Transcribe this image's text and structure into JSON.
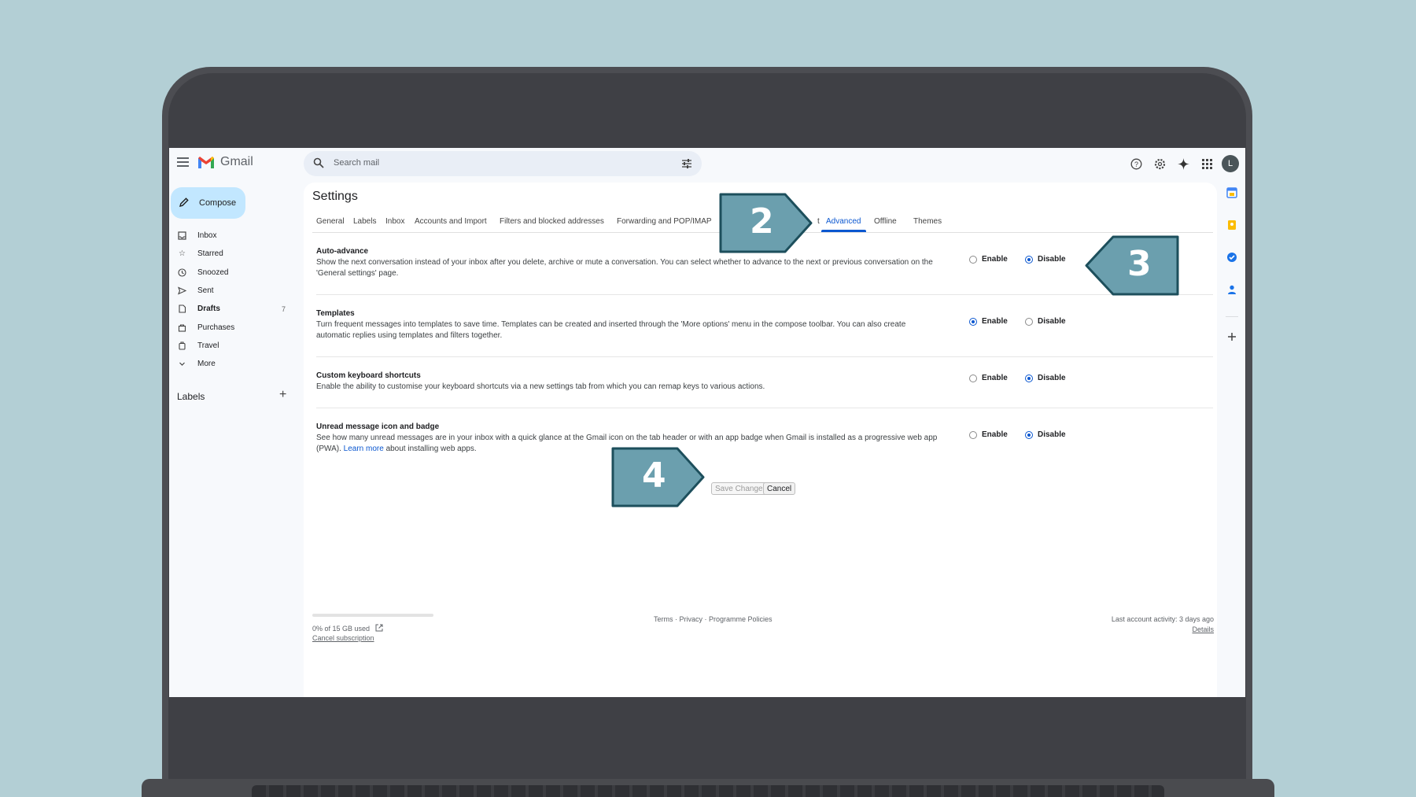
{
  "app": {
    "name": "Gmail"
  },
  "search": {
    "placeholder": "Search mail"
  },
  "header": {
    "avatar_letter": "L"
  },
  "sidebar": {
    "compose_label": "Compose",
    "items": [
      {
        "label": "Inbox",
        "icon": "inbox-icon",
        "count": ""
      },
      {
        "label": "Starred",
        "icon": "star-icon",
        "count": ""
      },
      {
        "label": "Snoozed",
        "icon": "clock-icon",
        "count": ""
      },
      {
        "label": "Sent",
        "icon": "send-icon",
        "count": ""
      },
      {
        "label": "Drafts",
        "icon": "draft-icon",
        "count": "7"
      },
      {
        "label": "Purchases",
        "icon": "bag-icon",
        "count": ""
      },
      {
        "label": "Travel",
        "icon": "luggage-icon",
        "count": ""
      },
      {
        "label": "More",
        "icon": "chevron-down-icon",
        "count": ""
      }
    ],
    "labels_title": "Labels"
  },
  "settings": {
    "title": "Settings",
    "tabs": [
      "General",
      "Labels",
      "Inbox",
      "Accounts and Import",
      "Filters and blocked addresses",
      "Forwarding and POP/IMAP",
      "t",
      "Advanced",
      "Offline",
      "Themes"
    ],
    "active_tab": "Advanced",
    "rows": [
      {
        "title": "Auto-advance",
        "desc": "Show the next conversation instead of your inbox after you delete, archive or mute a conversation. You can select whether to advance to the next or previous conversation on the 'General settings' page.",
        "selected": "Disable"
      },
      {
        "title": "Templates",
        "desc": "Turn frequent messages into templates to save time. Templates can be created and inserted through the 'More options' menu in the compose toolbar. You can also create automatic replies using templates and filters together.",
        "selected": "Enable"
      },
      {
        "title": "Custom keyboard shortcuts",
        "desc": "Enable the ability to customise your keyboard shortcuts via a new settings tab from which you can remap keys to various actions.",
        "selected": "Disable"
      },
      {
        "title": "Unread message icon and badge",
        "desc_before": "See how many unread messages are in your inbox with a quick glance at the Gmail icon on the tab header or with an app badge when Gmail is installed as a progressive web app (PWA).",
        "link": "Learn more",
        "desc_after": "about installing web apps.",
        "selected": "Disable"
      }
    ],
    "enable_label": "Enable",
    "disable_label": "Disable",
    "save_label": "Save Changes",
    "cancel_label": "Cancel"
  },
  "footer": {
    "storage": "0% of 15 GB used",
    "storage_fraction": 0.0,
    "cancel_subscription": "Cancel subscription",
    "links": "Terms · Privacy · Programme Policies",
    "activity": "Last account activity: 3 days ago",
    "details": "Details"
  },
  "callouts": [
    "2",
    "3",
    "4"
  ],
  "colors": {
    "accent": "#0b57d0",
    "callout_fill": "#6b9fae",
    "callout_stroke": "#1d4f5c",
    "background": "#b3cfd5"
  }
}
